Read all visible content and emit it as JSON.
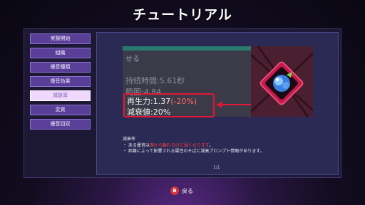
{
  "title": "チュートリアル",
  "sidebar": {
    "items": [
      {
        "label": "実験開始",
        "active": false
      },
      {
        "label": "組織",
        "active": false
      },
      {
        "label": "擾音種類",
        "active": false
      },
      {
        "label": "擾音効果",
        "active": false
      },
      {
        "label": "減衰率",
        "active": true
      },
      {
        "label": "変異",
        "active": false
      },
      {
        "label": "擾音回収",
        "active": false
      }
    ]
  },
  "preview": {
    "header": "せる",
    "duration": "持続時間:5.61秒",
    "range": "範囲:4.84",
    "regen_label": "再生力:1.37",
    "regen_delta": "(-20%)",
    "decay": "減衰値:20%"
  },
  "description": {
    "title": "減衰率",
    "line1_pre": "・ ある擾音は",
    "line1_em": "源から離れるほど弱くなります",
    "line1_post": "。",
    "line2": "・ 距離によって影響される属性のそばに減衰プロンプト情報があります。"
  },
  "pagination": "1/1",
  "footer": {
    "button_glyph": "B",
    "back_label": "戻る"
  },
  "colors": {
    "highlight": "#e01835",
    "active_tab": "#f0d8ff",
    "accent": "#5a3f98"
  }
}
